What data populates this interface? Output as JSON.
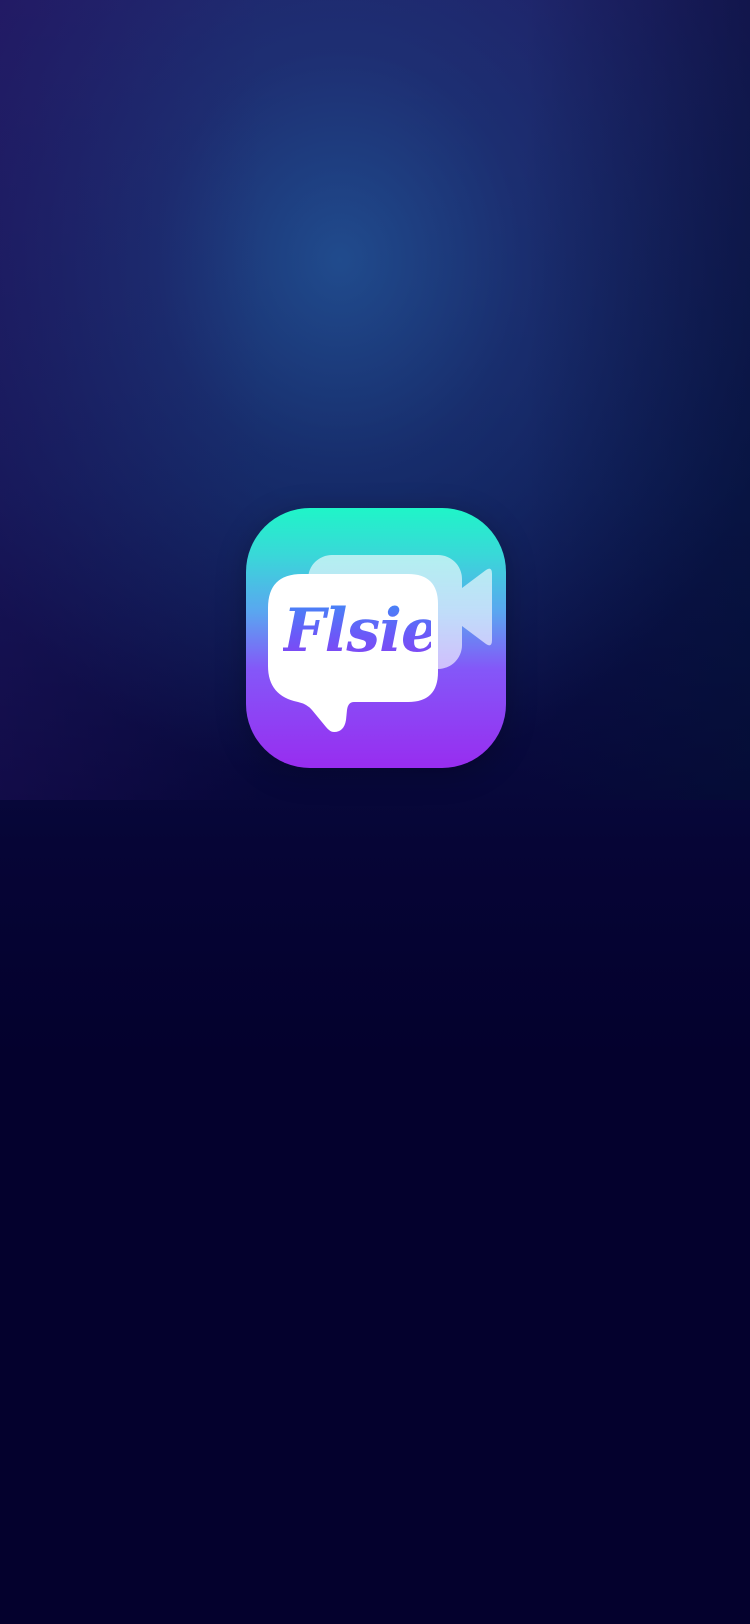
{
  "splash": {
    "app_name": "Flsie",
    "icon": "video-chat-bubble-icon"
  },
  "colors": {
    "background_top": "#1f1a62",
    "background_bottom": "#04012d",
    "icon_gradient_top": "#1ff5c8",
    "icon_gradient_bottom": "#982df0",
    "bubble": "#ffffff"
  }
}
